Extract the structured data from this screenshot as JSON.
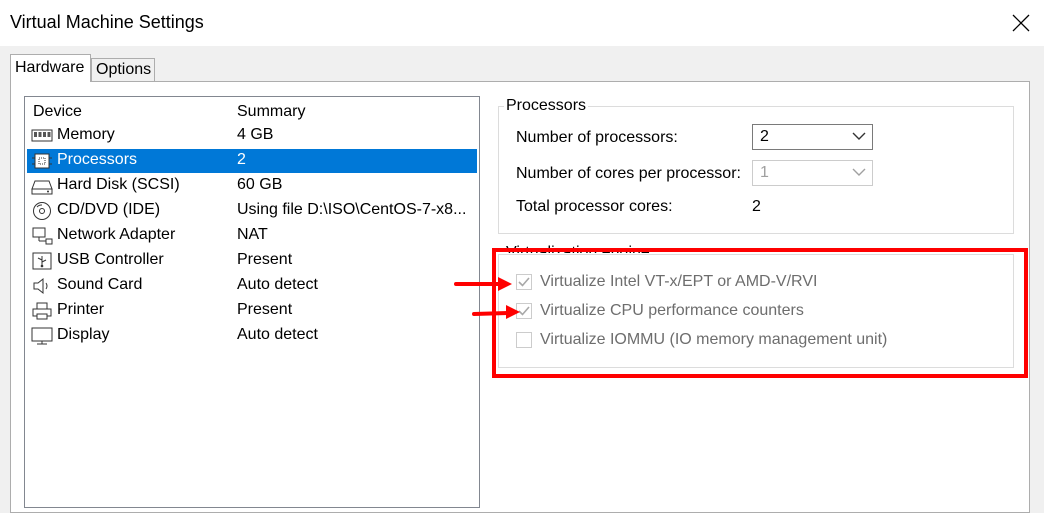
{
  "window": {
    "title": "Virtual Machine Settings"
  },
  "tabs": [
    {
      "label": "Hardware"
    },
    {
      "label": "Options"
    }
  ],
  "device_list": {
    "headers": {
      "device": "Device",
      "summary": "Summary"
    },
    "rows": [
      {
        "name": "Memory",
        "summary": "4 GB",
        "icon": "memory-icon"
      },
      {
        "name": "Processors",
        "summary": "2",
        "icon": "processor-icon"
      },
      {
        "name": "Hard Disk (SCSI)",
        "summary": "60 GB",
        "icon": "hard-disk-icon"
      },
      {
        "name": "CD/DVD (IDE)",
        "summary": "Using file D:\\ISO\\CentOS-7-x8...",
        "icon": "cd-dvd-icon"
      },
      {
        "name": "Network Adapter",
        "summary": "NAT",
        "icon": "network-adapter-icon"
      },
      {
        "name": "USB Controller",
        "summary": "Present",
        "icon": "usb-icon"
      },
      {
        "name": "Sound Card",
        "summary": "Auto detect",
        "icon": "speaker-icon"
      },
      {
        "name": "Printer",
        "summary": "Present",
        "icon": "printer-icon"
      },
      {
        "name": "Display",
        "summary": "Auto detect",
        "icon": "monitor-icon"
      }
    ],
    "selected_index": 1
  },
  "processors": {
    "group_label": "Processors",
    "num_processors_label": "Number of processors:",
    "num_processors_value": "2",
    "cores_label": "Number of cores per processor:",
    "cores_value": "1",
    "total_label": "Total processor cores:",
    "total_value": "2"
  },
  "virtualization": {
    "group_label": "Virtualization engine",
    "options": [
      {
        "label": "Virtualize Intel VT-x/EPT or AMD-V/RVI",
        "checked": true
      },
      {
        "label": "Virtualize CPU performance counters",
        "checked": true
      },
      {
        "label": "Virtualize IOMMU (IO memory management unit)",
        "checked": false
      }
    ]
  },
  "colors": {
    "selection": "#0078d7",
    "annotation_red": "#ff0000"
  }
}
